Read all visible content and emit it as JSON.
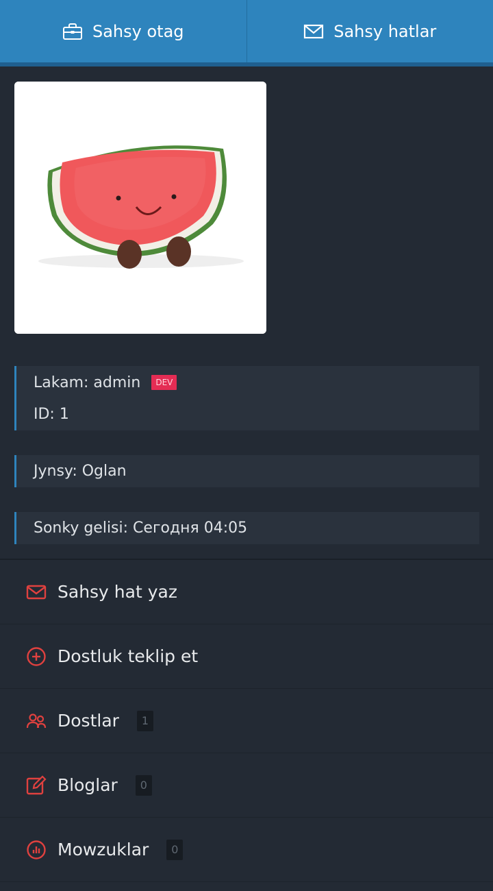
{
  "topbar": {
    "tabs": [
      {
        "label": "Sahsy otag",
        "icon": "briefcase-icon"
      },
      {
        "label": "Sahsy hatlar",
        "icon": "envelope-icon"
      }
    ]
  },
  "profile": {
    "photo_alt": "watermelon plush toy",
    "nickname": "Lakam: admin",
    "badge": "DEV",
    "id": "ID: 1",
    "gender": "Jynsy: Oglan",
    "last_seen": "Sonky gelisi: Сегодня 04:05"
  },
  "menu": {
    "items": [
      {
        "label": "Sahsy hat yaz",
        "icon": "envelope-icon"
      },
      {
        "label": "Dostluk teklip et",
        "icon": "plus-circle-icon"
      },
      {
        "label": "Dostlar",
        "icon": "users-icon",
        "count": "1"
      },
      {
        "label": "Bloglar",
        "icon": "edit-icon",
        "count": "0"
      },
      {
        "label": "Mowzuklar",
        "icon": "chart-circle-icon",
        "count": "0"
      }
    ]
  },
  "colors": {
    "topbar": "#2e84bd",
    "background": "#232a34",
    "accent_red": "#e0413f",
    "badge": "#e42c54"
  }
}
